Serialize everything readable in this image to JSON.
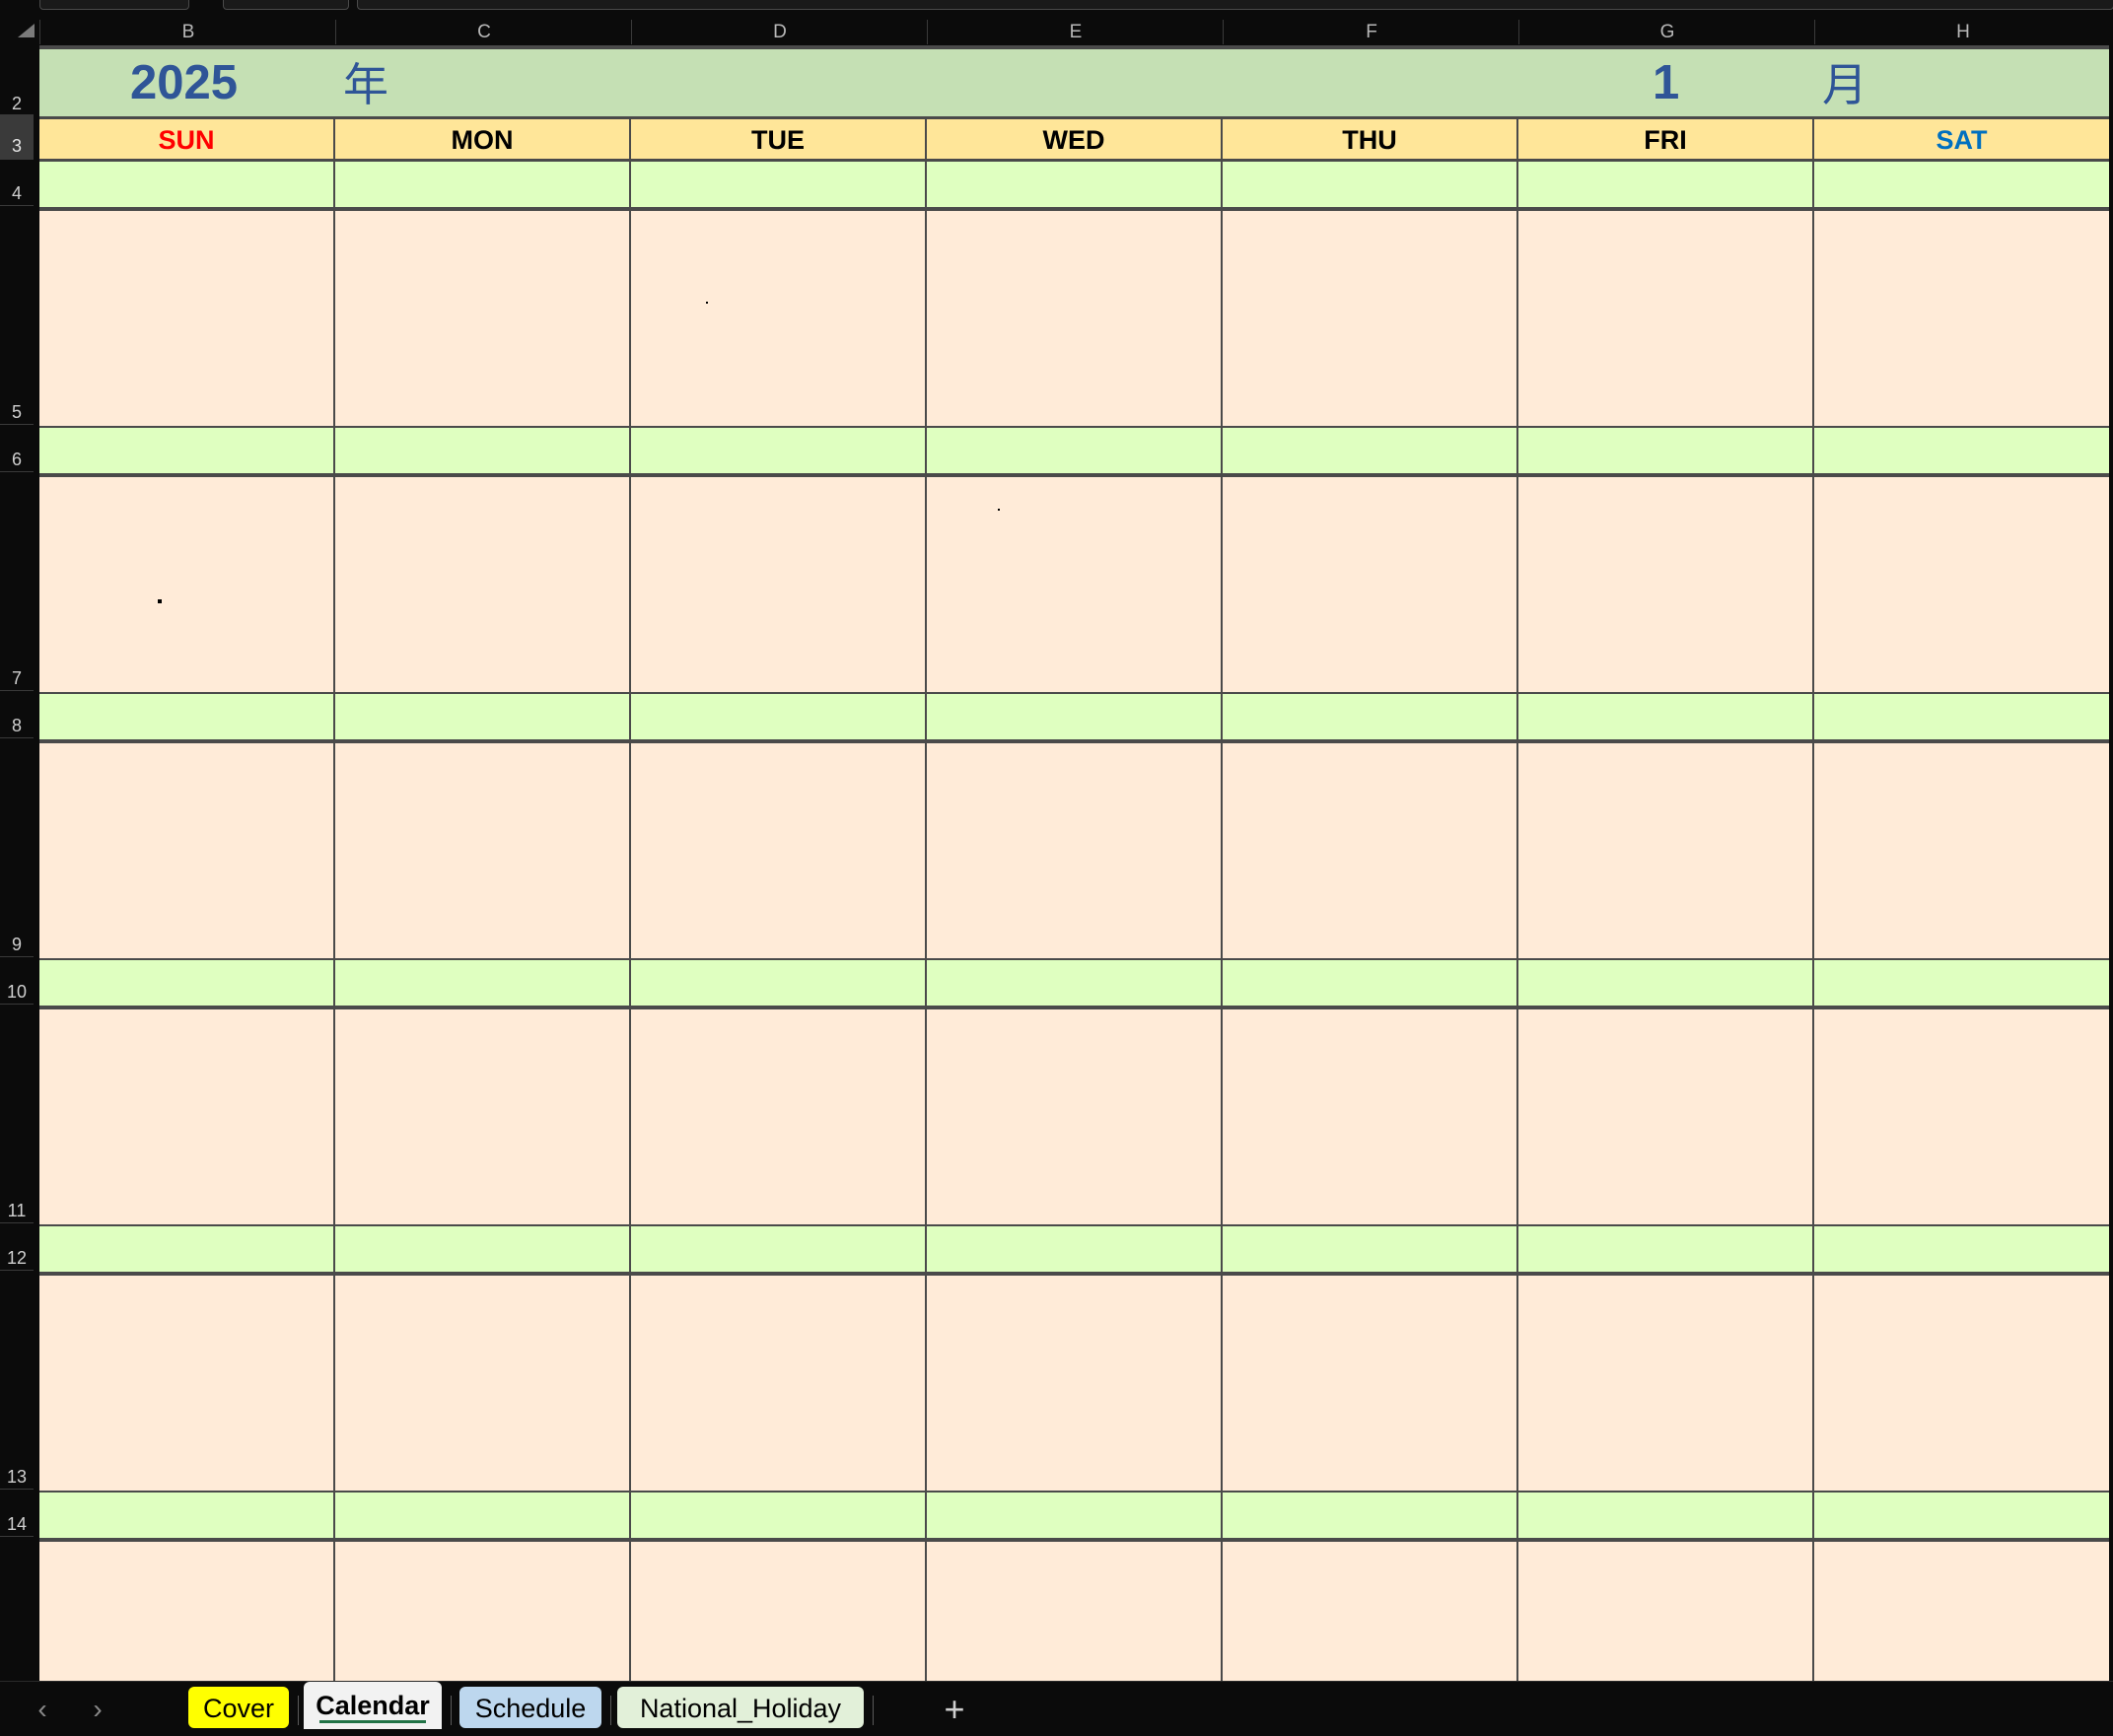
{
  "columns": [
    "B",
    "C",
    "D",
    "E",
    "F",
    "G",
    "H"
  ],
  "rows": [
    "2",
    "3",
    "4",
    "5",
    "6",
    "7",
    "8",
    "9",
    "10",
    "11",
    "12",
    "13",
    "14"
  ],
  "calendar": {
    "year": "2025",
    "year_suffix": "年",
    "month": "1",
    "month_suffix": "月",
    "weekdays": [
      "SUN",
      "MON",
      "TUE",
      "WED",
      "THU",
      "FRI",
      "SAT"
    ],
    "colors": {
      "title_bg": "#c5e0b4",
      "title_text": "#2f5597",
      "weekday_bg": "#ffe699",
      "sunday": "#ff0000",
      "saturday": "#0070c0",
      "date_row_bg": "#dfffc0",
      "body_row_bg": "#ffebd8"
    }
  },
  "tabs": {
    "prev_label": "‹",
    "next_label": "›",
    "sheets": [
      "Cover",
      "Calendar",
      "Schedule",
      "National_Holiday"
    ],
    "sheet_colors": [
      "#ffff00",
      "#f2f2f2",
      "#bdd7ee",
      "#e2f0d9"
    ],
    "active_sheet": "Calendar",
    "add_label": "+"
  }
}
